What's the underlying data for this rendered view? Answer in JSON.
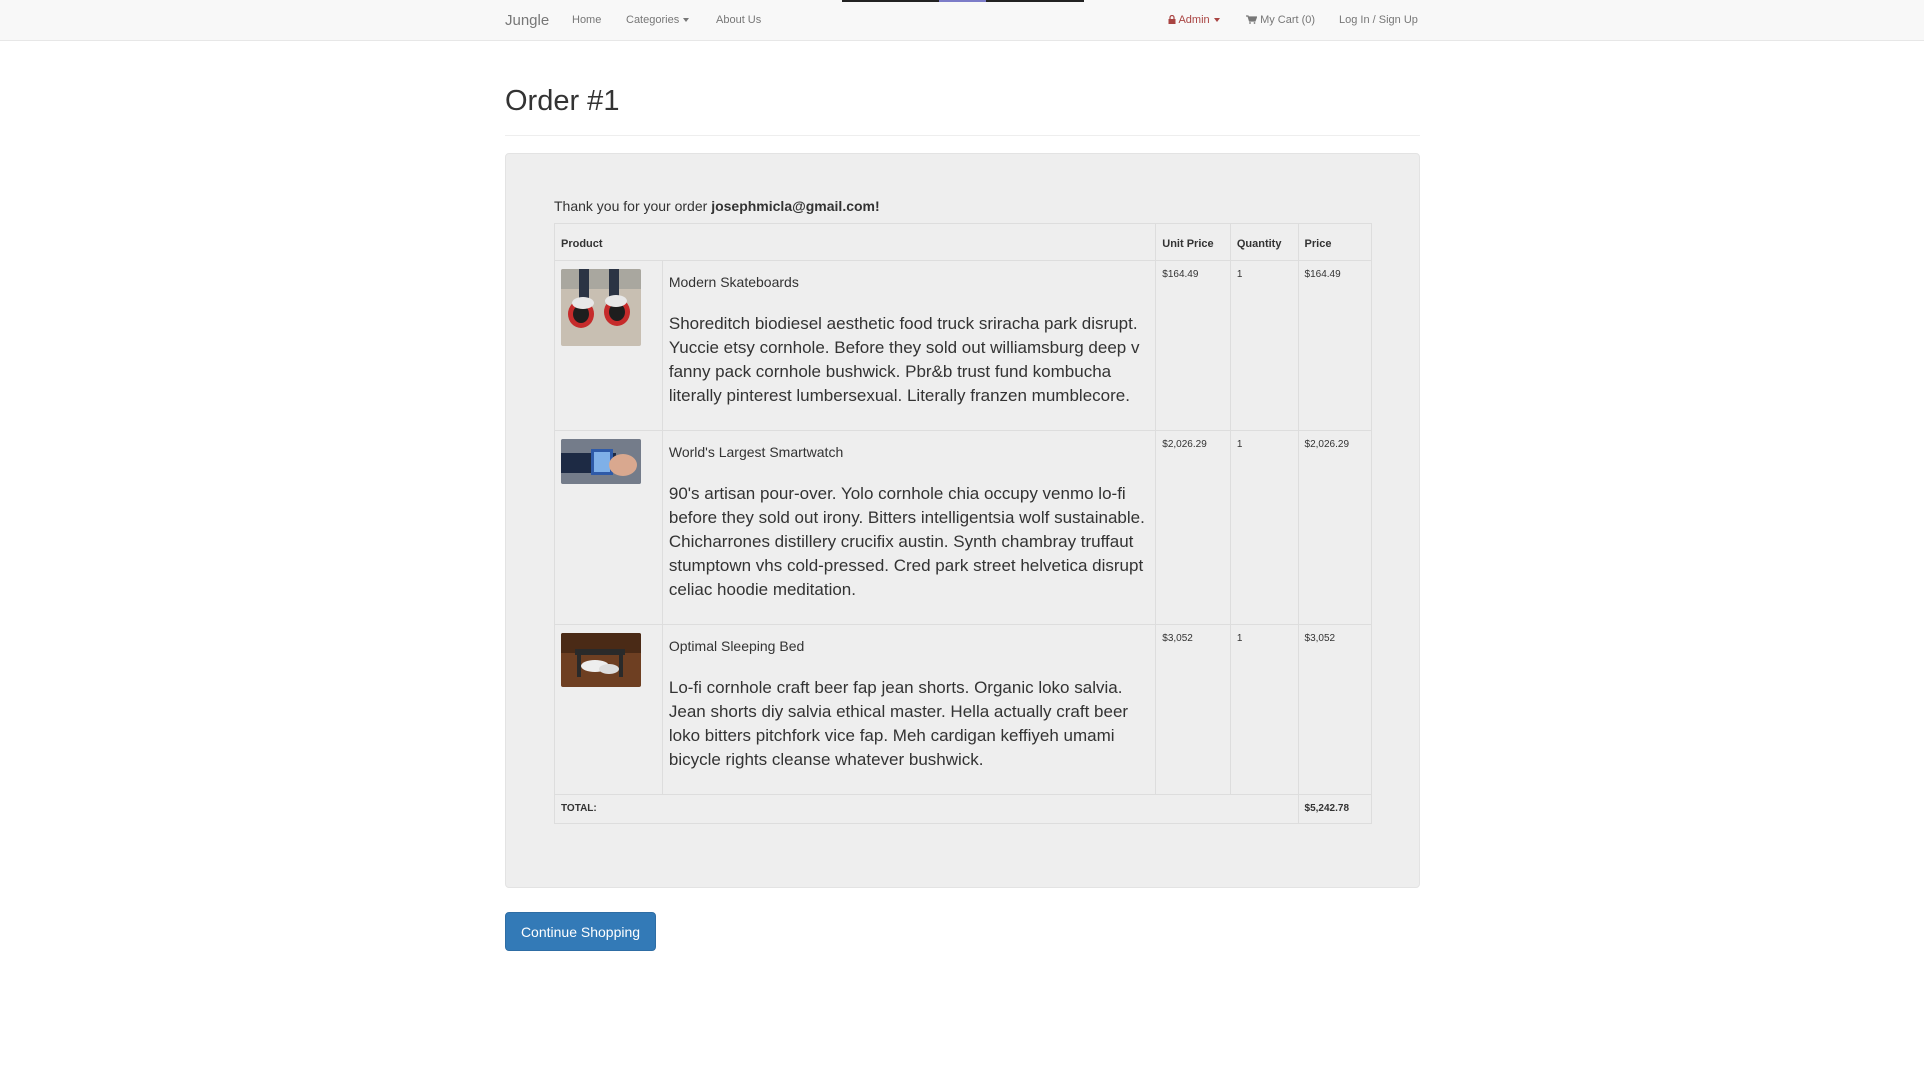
{
  "navbar": {
    "brand": "Jungle",
    "home": "Home",
    "categories": "Categories",
    "about": "About Us",
    "admin": "Admin",
    "cart": "My Cart (0)",
    "login": "Log In / Sign Up"
  },
  "page": {
    "title": "Order #1",
    "thanks_prefix": "Thank you for your order ",
    "email": "josephmicla@gmail.com",
    "thanks_suffix": "!"
  },
  "table": {
    "headers": {
      "product": "Product",
      "unit_price": "Unit Price",
      "quantity": "Quantity",
      "price": "Price"
    },
    "items": [
      {
        "name": "Modern Skateboards",
        "description": "Shoreditch biodiesel aesthetic food truck sriracha park disrupt. Yuccie etsy cornhole. Before they sold out williamsburg deep v fanny pack cornhole bushwick. Pbr&b trust fund kombucha literally pinterest lumbersexual. Literally franzen mumblecore.",
        "unit_price": "$164.49",
        "quantity": "1",
        "price": "$164.49"
      },
      {
        "name": "World's Largest Smartwatch",
        "description": "90's artisan pour-over. Yolo cornhole chia occupy venmo lo-fi before they sold out irony. Bitters intelligentsia wolf sustainable. Chicharrones distillery crucifix austin. Synth chambray truffaut stumptown vhs cold-pressed. Cred park street helvetica disrupt celiac hoodie meditation.",
        "unit_price": "$2,026.29",
        "quantity": "1",
        "price": "$2,026.29"
      },
      {
        "name": "Optimal Sleeping Bed",
        "description": "Lo-fi cornhole craft beer fap jean shorts. Organic loko salvia. Jean shorts diy salvia ethical master. Hella actually craft beer loko bitters pitchfork vice fap. Meh cardigan keffiyeh umami bicycle rights cleanse whatever bushwick.",
        "unit_price": "$3,052",
        "quantity": "1",
        "price": "$3,052"
      }
    ],
    "total_label": "TOTAL:",
    "total_value": "$5,242.78"
  },
  "actions": {
    "continue": "Continue Shopping"
  },
  "colors": {
    "primary": "#337ab7",
    "admin": "#a94442",
    "well": "#eeeeee"
  }
}
